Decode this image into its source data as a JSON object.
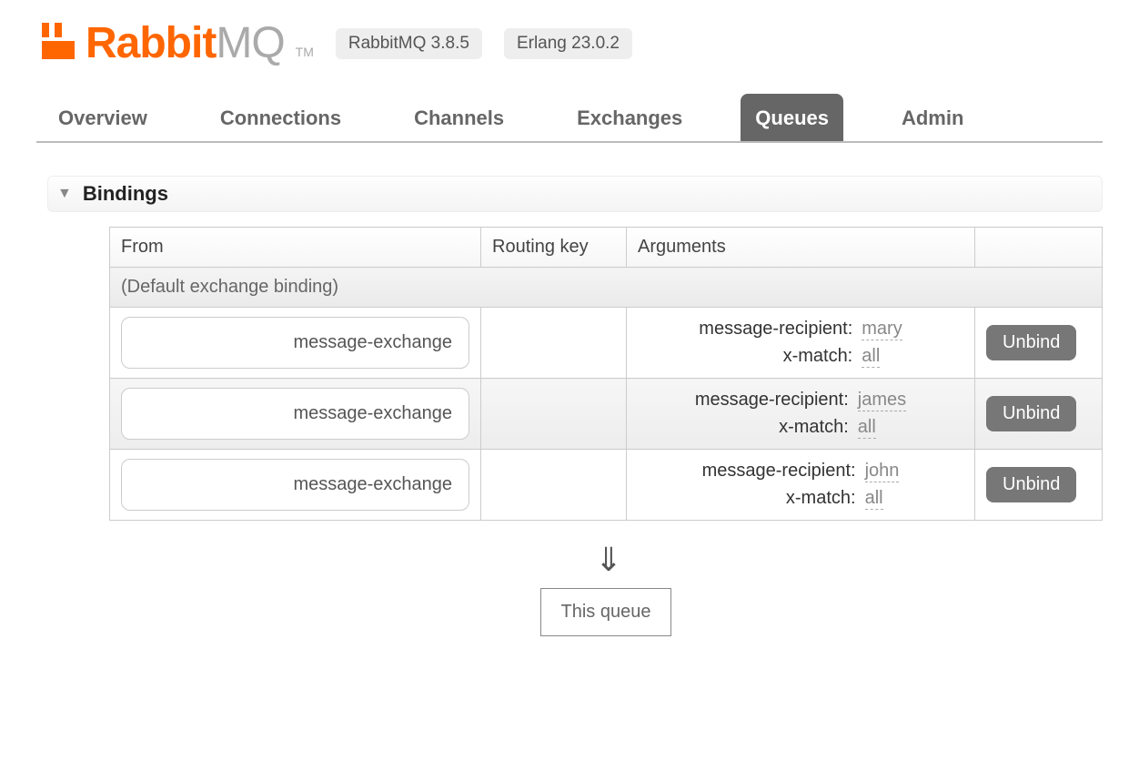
{
  "brand": {
    "name_left": "Rabbit",
    "name_right": "MQ",
    "tm": "TM"
  },
  "badges": {
    "rabbitmq": "RabbitMQ 3.8.5",
    "erlang": "Erlang 23.0.2"
  },
  "tabs": [
    {
      "label": "Overview"
    },
    {
      "label": "Connections"
    },
    {
      "label": "Channels"
    },
    {
      "label": "Exchanges"
    },
    {
      "label": "Queues",
      "active": true
    },
    {
      "label": "Admin"
    }
  ],
  "section": {
    "title": "Bindings"
  },
  "table": {
    "headers": {
      "from": "From",
      "routing_key": "Routing key",
      "arguments": "Arguments"
    },
    "default_row": "(Default exchange binding)",
    "rows": [
      {
        "from": "message-exchange",
        "routing_key": "",
        "args": [
          {
            "k": "message-recipient:",
            "v": "mary"
          },
          {
            "k": "x-match:",
            "v": "all"
          }
        ]
      },
      {
        "from": "message-exchange",
        "routing_key": "",
        "args": [
          {
            "k": "message-recipient:",
            "v": "james"
          },
          {
            "k": "x-match:",
            "v": "all"
          }
        ]
      },
      {
        "from": "message-exchange",
        "routing_key": "",
        "args": [
          {
            "k": "message-recipient:",
            "v": "john"
          },
          {
            "k": "x-match:",
            "v": "all"
          }
        ]
      }
    ],
    "unbind_label": "Unbind"
  },
  "flow": {
    "this_queue": "This queue"
  }
}
